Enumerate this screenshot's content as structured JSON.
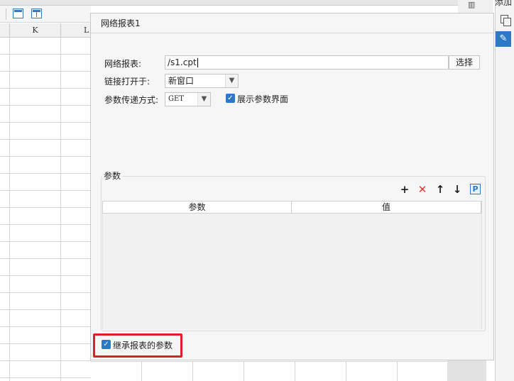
{
  "spreadsheet": {
    "columns": [
      "K",
      "L"
    ]
  },
  "right_panel": {
    "title": "添加",
    "top_icon": "grid-icon"
  },
  "dialog": {
    "title": "网络报表1",
    "report_label": "网络报表:",
    "report_value": "/s1.cpt",
    "choose_button": "选择",
    "open_in_label": "链接打开于:",
    "open_in_value": "新窗口",
    "method_label": "参数传递方式:",
    "method_value": "GET",
    "show_params_label": "展示参数界面",
    "show_params_checked": true,
    "params_group_title": "参数",
    "table_headers": [
      "参数",
      "值"
    ],
    "inherit_label": "继承报表的参数",
    "inherit_checked": true,
    "highlight_color": "#e02020",
    "accent_color": "#2d79c7"
  }
}
